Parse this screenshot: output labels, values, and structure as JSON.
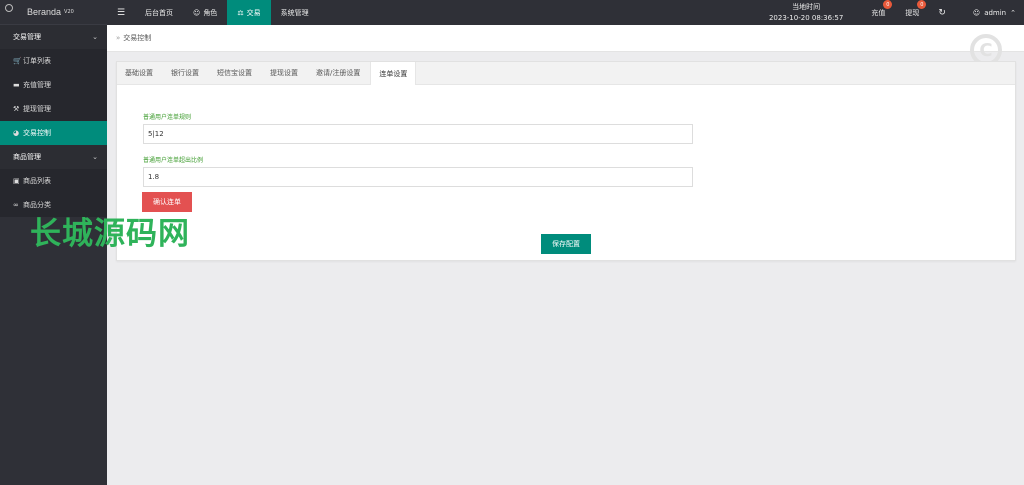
{
  "app": {
    "brand": "Beranda",
    "version": "V20"
  },
  "sidebar": {
    "groups": [
      {
        "label": "交易管理",
        "items": [
          "订单列表",
          "充值管理",
          "提现管理",
          "交易控制"
        ]
      },
      {
        "label": "商品管理",
        "items": [
          "商品列表",
          "商品分类"
        ]
      }
    ]
  },
  "topbar": {
    "nav": [
      "后台首页",
      "角色",
      "交易",
      "系统管理"
    ],
    "clock_label": "当地时间",
    "clock_value": "2023-10-20 08:36:57",
    "recharge": "充值",
    "recharge_badge": "0",
    "withdraw": "提现",
    "withdraw_badge": "0",
    "user": "admin"
  },
  "breadcrumb": {
    "current": "交易控制"
  },
  "tabs": [
    "基础设置",
    "银行设置",
    "短信宝设置",
    "提现设置",
    "邀请/注册设置",
    "连单设置"
  ],
  "form": {
    "rule_label": "普通用户连单规则",
    "rule_value": "5|12",
    "ratio_label": "普通用户连单超出比例",
    "ratio_value": "1.8",
    "confirm_button": "确认连单",
    "save_button": "保存配置"
  },
  "watermark": {
    "text": "长城源码网",
    "logo_letter": "C"
  },
  "colors": {
    "accent": "#008c7c",
    "danger": "#e35151",
    "sidebar": "#2f3037",
    "badge": "#e8593a",
    "label_green": "#3a9a2a"
  }
}
